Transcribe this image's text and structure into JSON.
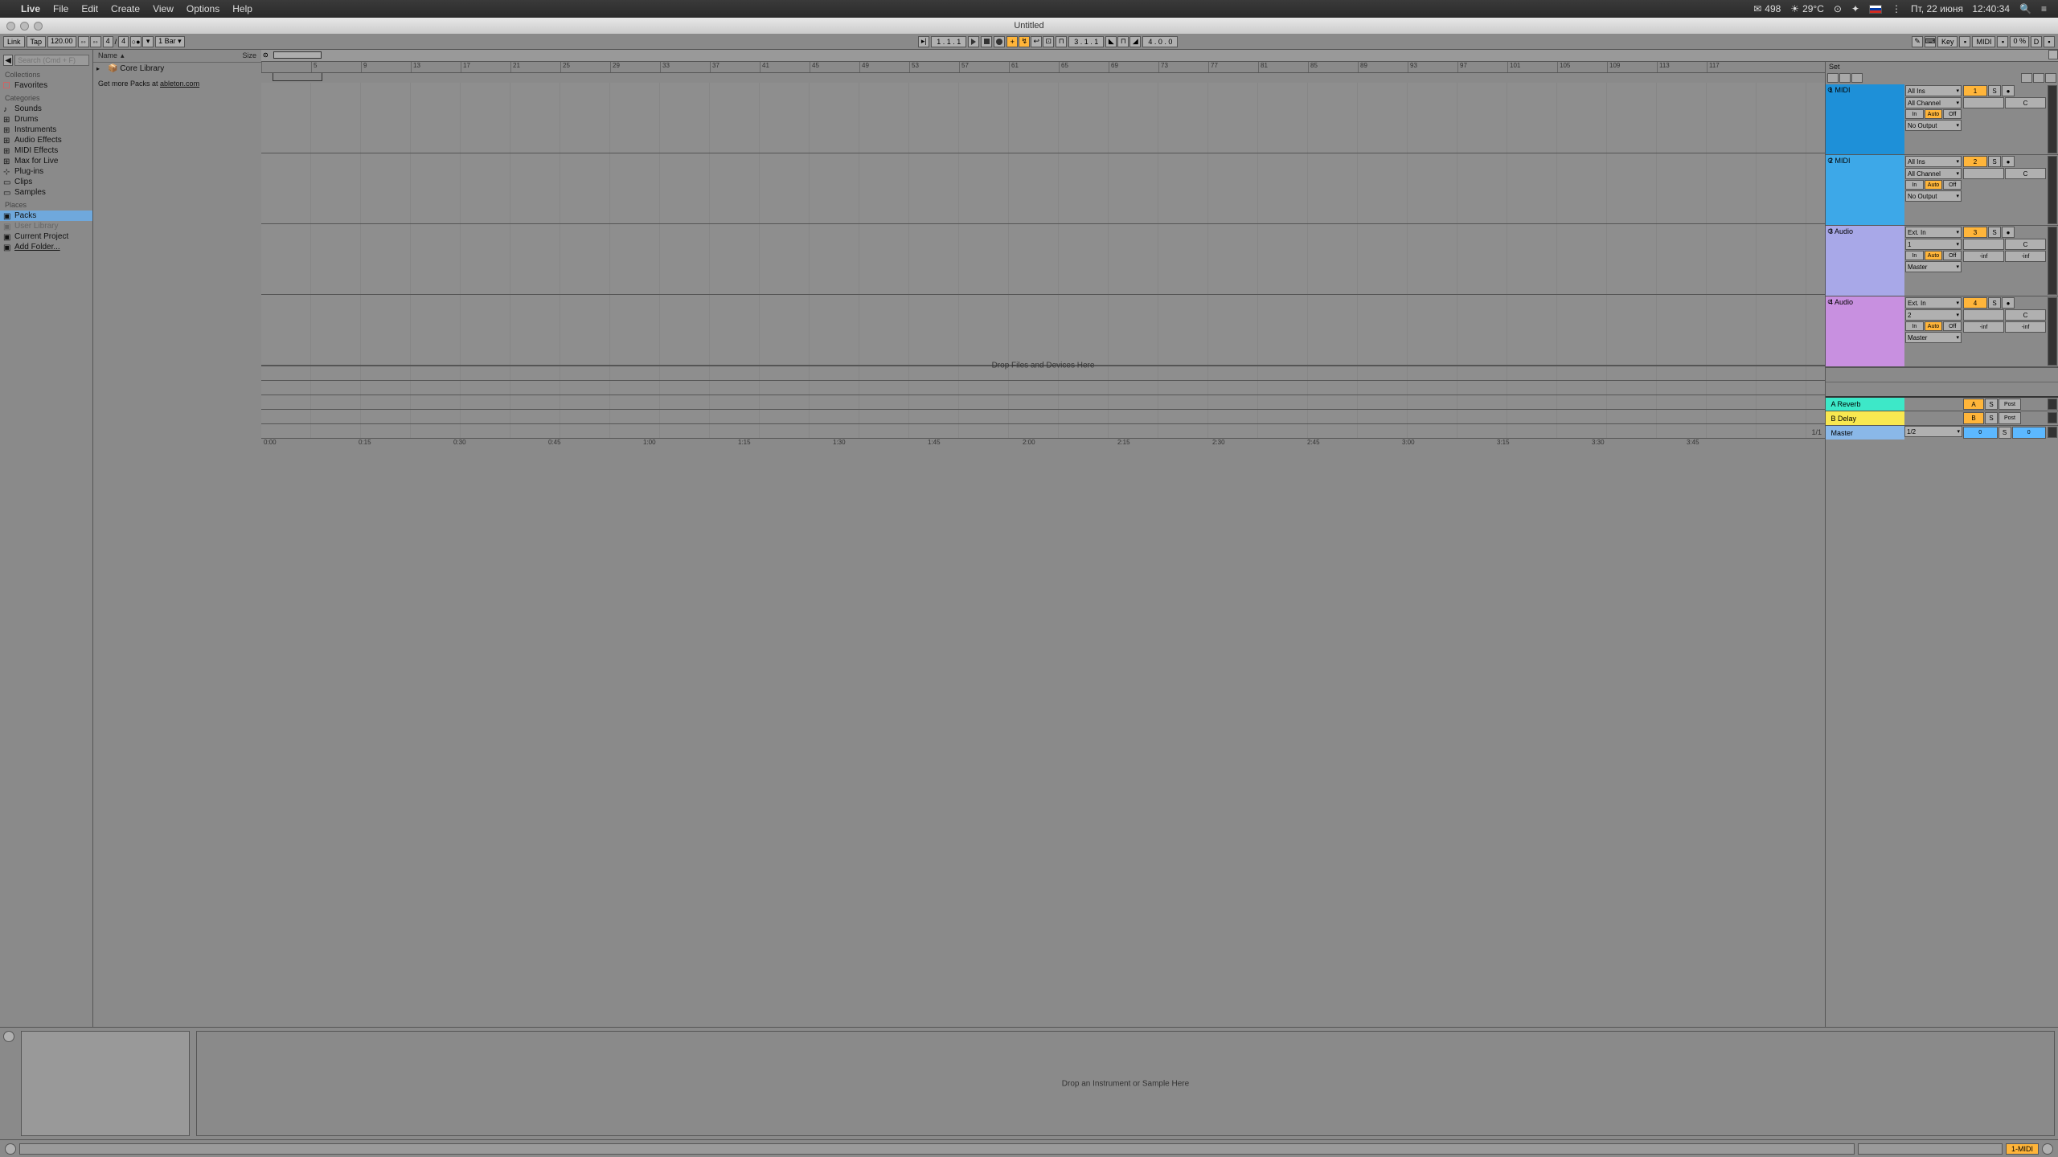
{
  "menubar": {
    "app": "Live",
    "items": [
      "File",
      "Edit",
      "Create",
      "View",
      "Options",
      "Help"
    ],
    "mail_count": "498",
    "temp": "29°C",
    "date": "Пт, 22 июня",
    "time": "12:40:34"
  },
  "window": {
    "title": "Untitled"
  },
  "toolbar": {
    "link": "Link",
    "tap": "Tap",
    "tempo": "120.00",
    "sig_num": "4",
    "sig_den": "4",
    "quantize": "1 Bar",
    "position": "1 .  1 .  1",
    "loop_start": "3 .  1 .  1",
    "loop_len": "4 .  0 .  0",
    "pencil": "✎",
    "key": "Key",
    "midi": "MIDI",
    "cpu": "0 %",
    "disk": "D"
  },
  "browser": {
    "search_placeholder": "Search (Cmd + F)",
    "collections": "Collections",
    "favorites": "Favorites",
    "categories_label": "Categories",
    "categories": [
      "Sounds",
      "Drums",
      "Instruments",
      "Audio Effects",
      "MIDI Effects",
      "Max for Live",
      "Plug-ins",
      "Clips",
      "Samples"
    ],
    "places_label": "Places",
    "places": [
      "Packs",
      "User Library",
      "Current Project",
      "Add Folder..."
    ],
    "col_name": "Name",
    "col_size": "Size",
    "item_core": "Core Library",
    "packs_msg_pre": "Get more Packs at ",
    "packs_link": "ableton.com"
  },
  "arrange": {
    "set_label": "Set",
    "ruler_marks": [
      "",
      "5",
      "9",
      "13",
      "17",
      "21",
      "25",
      "29",
      "33",
      "37",
      "41",
      "45",
      "49",
      "53",
      "57",
      "61",
      "65",
      "69",
      "73",
      "77",
      "81",
      "85",
      "89",
      "93",
      "97",
      "101",
      "105",
      "109",
      "113",
      "117"
    ],
    "time_marks": [
      "0:00",
      "0:15",
      "0:30",
      "0:45",
      "1:00",
      "1:15",
      "1:30",
      "1:45",
      "2:00",
      "2:15",
      "2:30",
      "2:45",
      "3:00",
      "3:15",
      "3:30",
      "3:45"
    ],
    "drop_text": "Drop Files and Devices Here",
    "voice": "1/1"
  },
  "tracks": [
    {
      "name": "1 MIDI",
      "input": "All Ins",
      "ch": "All Channel",
      "monitor_in": "In",
      "monitor_auto": "Auto",
      "monitor_off": "Off",
      "out": "No Output",
      "num": "1",
      "solo": "S"
    },
    {
      "name": "2 MIDI",
      "input": "All Ins",
      "ch": "All Channel",
      "monitor_in": "In",
      "monitor_auto": "Auto",
      "monitor_off": "Off",
      "out": "No Output",
      "num": "2",
      "solo": "S"
    },
    {
      "name": "3 Audio",
      "input": "Ext. In",
      "ch": "1",
      "monitor_in": "In",
      "monitor_auto": "Auto",
      "monitor_off": "Off",
      "out": "Master",
      "num": "3",
      "solo": "S",
      "inf": "-inf"
    },
    {
      "name": "4 Audio",
      "input": "Ext. In",
      "ch": "2",
      "monitor_in": "In",
      "monitor_auto": "Auto",
      "monitor_off": "Off",
      "out": "Master",
      "num": "4",
      "solo": "S",
      "inf": "-inf"
    }
  ],
  "returns": {
    "a": {
      "name": "A Reverb",
      "num": "A",
      "solo": "S",
      "post": "Post"
    },
    "b": {
      "name": "B Delay",
      "num": "B",
      "solo": "S",
      "post": "Post"
    },
    "master": {
      "name": "Master",
      "ch": "1/2",
      "num": "",
      "solo": "S",
      "vol": "0"
    }
  },
  "mixer_common": {
    "pan": "C",
    "rec": "●"
  },
  "device": {
    "drop_text": "Drop an Instrument or Sample Here"
  },
  "status": {
    "track": "1-MIDI"
  }
}
